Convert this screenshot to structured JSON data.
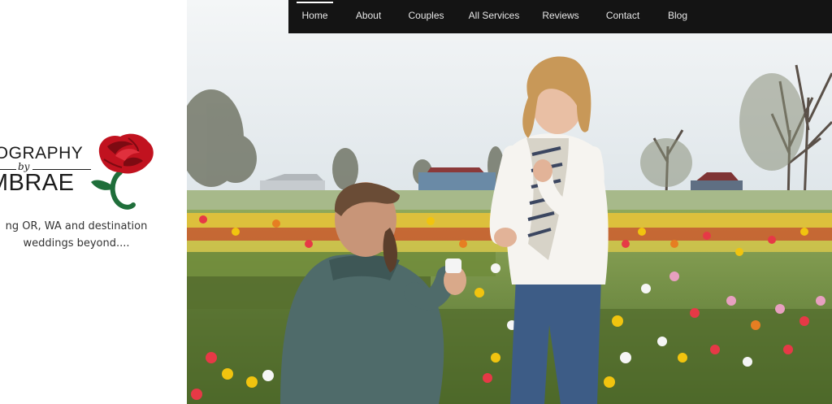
{
  "nav": {
    "items": [
      {
        "label": "Home",
        "active": true
      },
      {
        "label": "About",
        "active": false
      },
      {
        "label": "Couples",
        "active": false
      },
      {
        "label": "All Services",
        "active": false
      },
      {
        "label": "Reviews",
        "active": false
      },
      {
        "label": "Contact",
        "active": false
      },
      {
        "label": "Blog",
        "active": false
      }
    ]
  },
  "logo": {
    "line1": "OTOGRAPHY",
    "by": "by",
    "line2": "AMBRAE",
    "rose_color": "#c1121f",
    "stem_color": "#1f6e3a"
  },
  "tagline": {
    "line1": "ng OR, WA and destination",
    "line2": "weddings beyond...."
  },
  "colors": {
    "nav_bg": "#141414",
    "nav_text": "#e6e6e6",
    "page_bg": "#ffffff"
  }
}
